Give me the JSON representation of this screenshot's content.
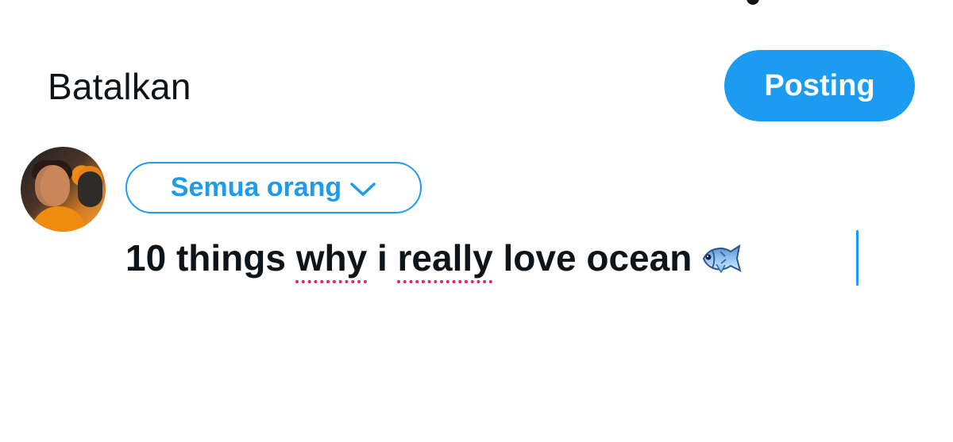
{
  "composer": {
    "cancel_label": "Batalkan",
    "post_label": "Posting",
    "audience": {
      "label": "Semua orang",
      "icon": "chevron-down-icon"
    },
    "text_parts": {
      "before_why": "10 things ",
      "why": "why",
      "between": " i ",
      "really": "really",
      "after": " love ocean"
    },
    "emoji": "fish-icon"
  },
  "colors": {
    "accent": "#1d9bf0",
    "text": "#0f1419",
    "spellcheck": "#e0245e",
    "background": "#ffffff"
  }
}
